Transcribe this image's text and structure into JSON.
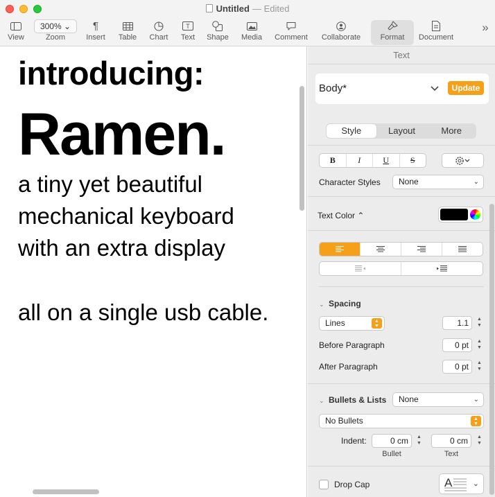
{
  "window": {
    "title": "Untitled",
    "status": "— Edited"
  },
  "toolbar": {
    "view": "View",
    "zoom_value": "300% ⌄",
    "zoom": "Zoom",
    "insert": "Insert",
    "table": "Table",
    "chart": "Chart",
    "text": "Text",
    "shape": "Shape",
    "media": "Media",
    "comment": "Comment",
    "collaborate": "Collaborate",
    "format": "Format",
    "document": "Document",
    "overflow": "»"
  },
  "document": {
    "line1": "introducing:",
    "line2": "Ramen.",
    "line3": "a tiny yet beautiful",
    "line4": "mechanical keyboard",
    "line5": "with an extra display",
    "line6": "all on a single usb cable."
  },
  "inspector": {
    "title": "Text",
    "paragraph_style": "Body*",
    "update": "Update",
    "tabs": [
      "Style",
      "Layout",
      "More"
    ],
    "active_tab": "Style",
    "font_buttons": [
      "B",
      "I",
      "U",
      "S"
    ],
    "character_styles_label": "Character Styles",
    "character_styles_value": "None",
    "text_color_label": "Text Color ⌃",
    "text_color": "#000000",
    "accent_color": "#f6a01a",
    "spacing_label": "Spacing",
    "line_spacing_mode": "Lines",
    "line_spacing_value": "1.1",
    "before_paragraph_label": "Before Paragraph",
    "before_paragraph_value": "0 pt",
    "after_paragraph_label": "After Paragraph",
    "after_paragraph_value": "0 pt",
    "bullets_label": "Bullets & Lists",
    "bullets_style": "None",
    "bullets_type": "No Bullets",
    "indent_label": "Indent:",
    "indent_bullet_value": "0 cm",
    "indent_text_value": "0 cm",
    "indent_bullet_caption": "Bullet",
    "indent_text_caption": "Text",
    "drop_cap_label": "Drop Cap",
    "drop_cap_glyph": "A"
  }
}
